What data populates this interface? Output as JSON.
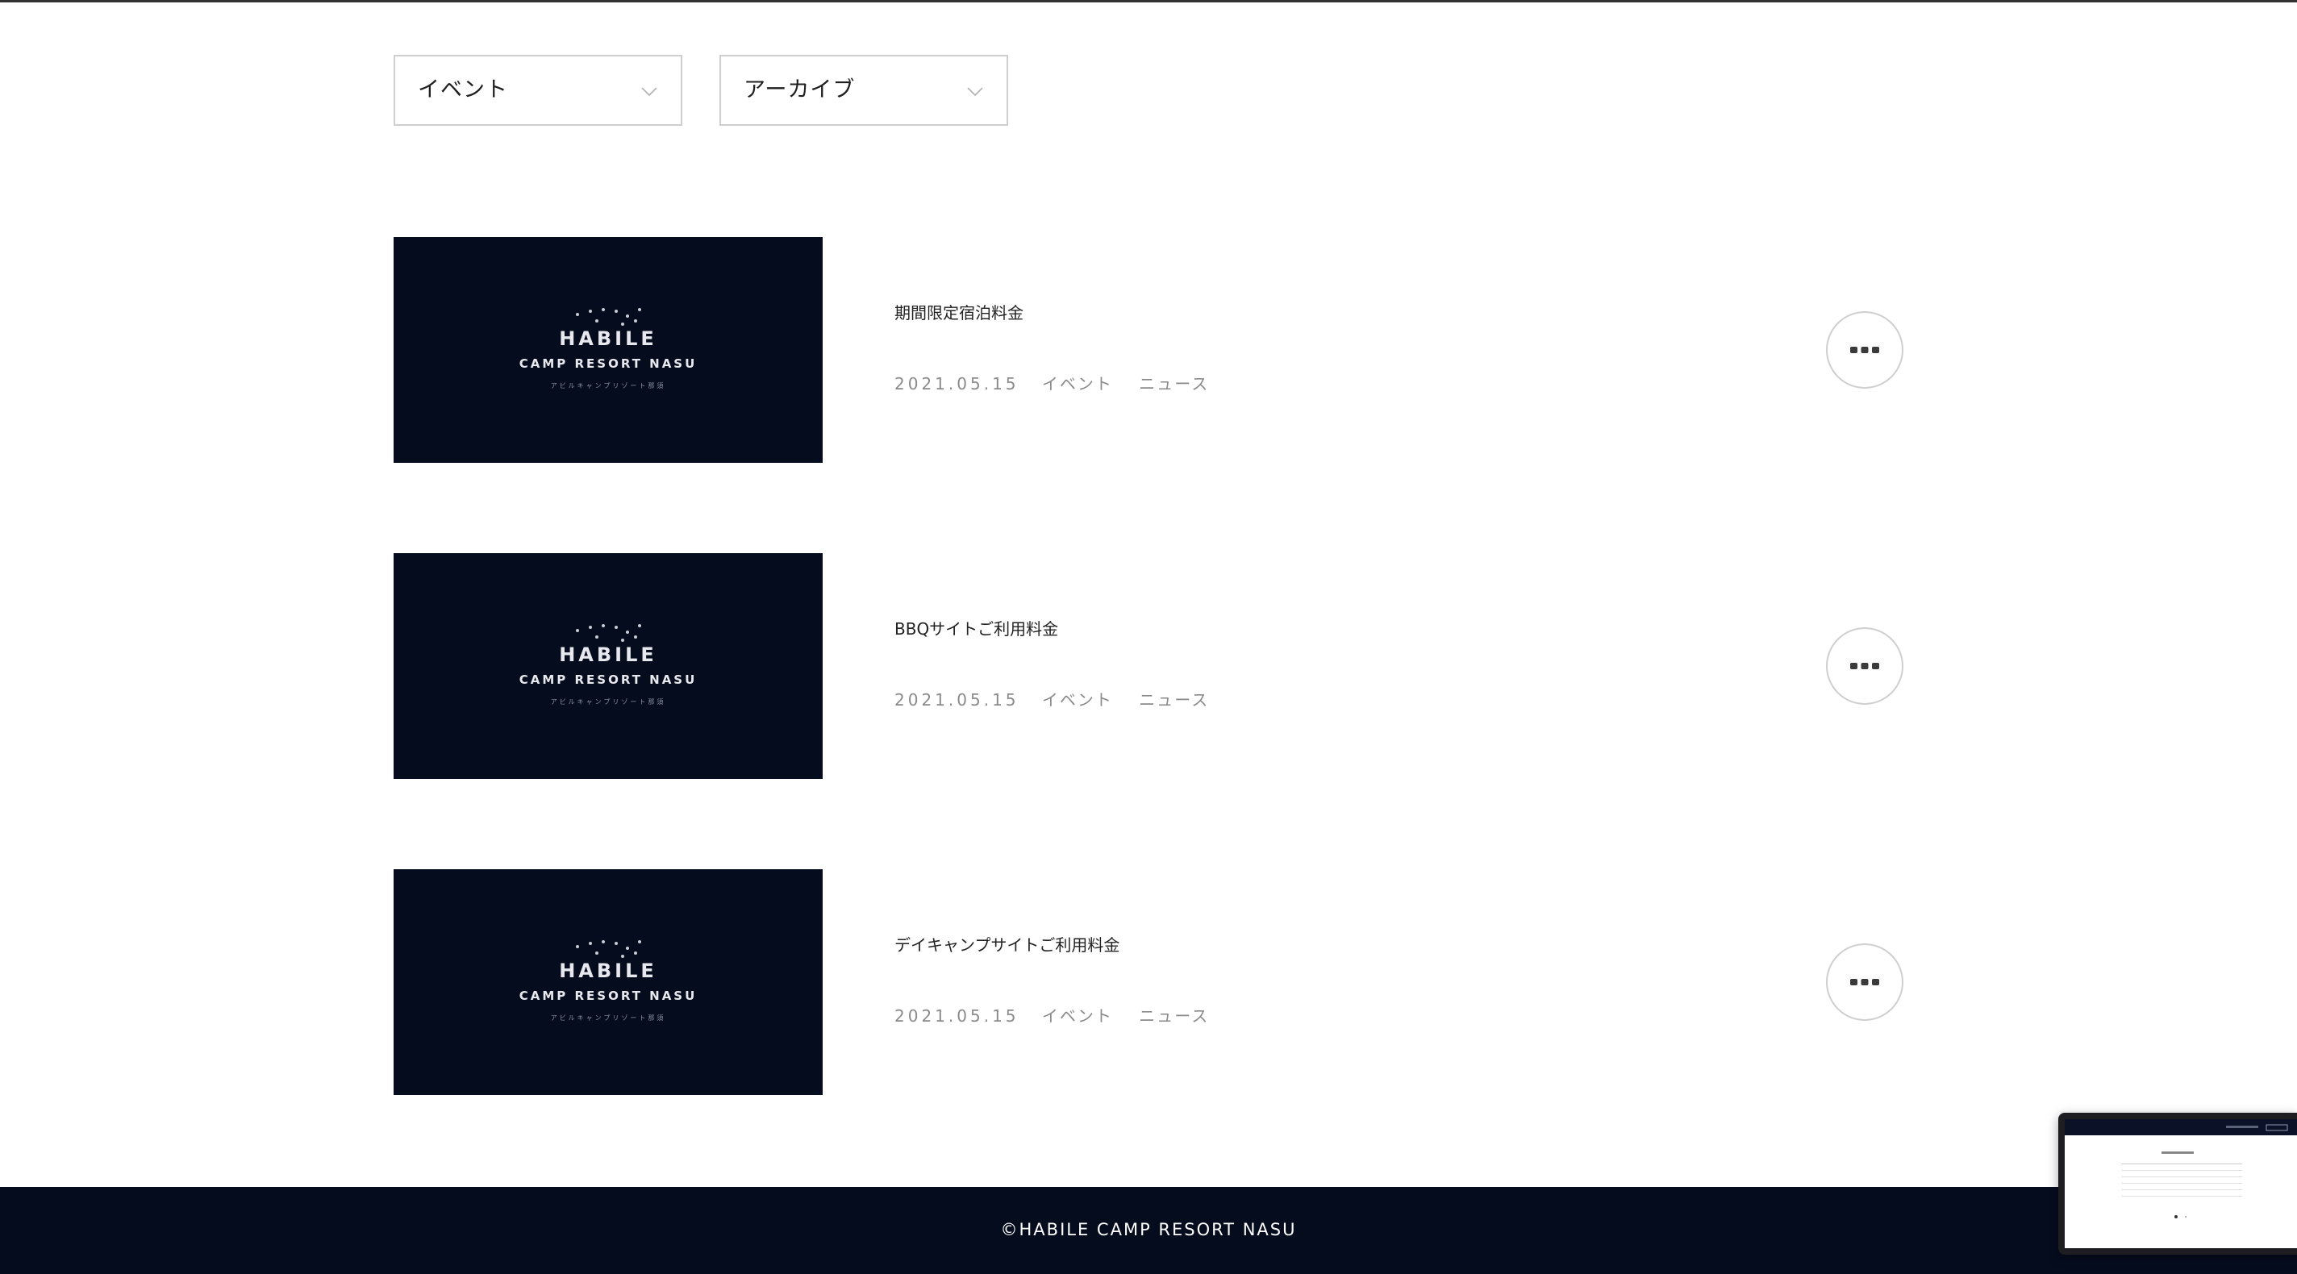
{
  "filters": {
    "category": {
      "selected": "イベント"
    },
    "archive": {
      "selected": "アーカイブ"
    }
  },
  "thumbnail_logo": {
    "brand": "HABILE",
    "line2": "CAMP RESORT NASU",
    "line3": "アビルキャンプリゾート那須"
  },
  "posts": [
    {
      "title": "期間限定宿泊料金",
      "date": "2021.05.15",
      "tags": [
        "イベント",
        "ニュース"
      ]
    },
    {
      "title": "BBQサイトご利用料金",
      "date": "2021.05.15",
      "tags": [
        "イベント",
        "ニュース"
      ]
    },
    {
      "title": "デイキャンプサイトご利用料金",
      "date": "2021.05.15",
      "tags": [
        "イベント",
        "ニュース"
      ]
    }
  ],
  "icons": {
    "filter_chevron": "chevron-down-icon",
    "post_more": "more-dots-icon"
  },
  "colors": {
    "navy": "#050c1e",
    "border": "#cfcfcf",
    "meta_text": "#8a8a8a",
    "footer_text": "#ffffff"
  },
  "footer": {
    "copyright": "©HABILE CAMP RESORT NASU"
  }
}
